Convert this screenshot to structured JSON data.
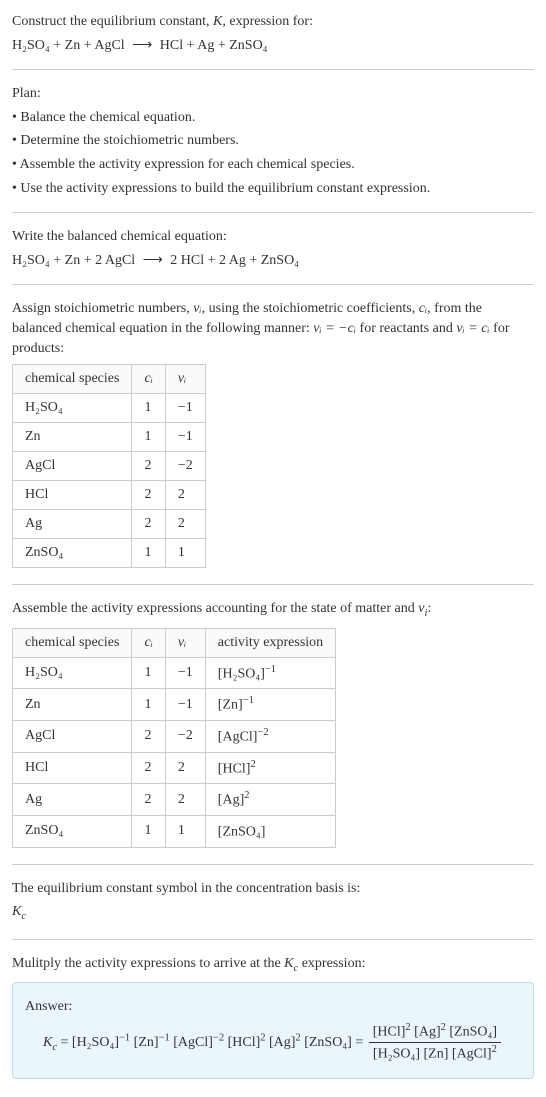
{
  "intro": {
    "line1": "Construct the equilibrium constant, K, expression for:",
    "equation_left": "H₂SO₄ + Zn + AgCl",
    "equation_right": "HCl + Ag + ZnSO₄"
  },
  "plan": {
    "heading": "Plan:",
    "items": [
      "• Balance the chemical equation.",
      "• Determine the stoichiometric numbers.",
      "• Assemble the activity expression for each chemical species.",
      "• Use the activity expressions to build the equilibrium constant expression."
    ]
  },
  "balanced": {
    "heading": "Write the balanced chemical equation:",
    "left": "H₂SO₄ + Zn + 2 AgCl",
    "right": "2 HCl + 2 Ag + ZnSO₄"
  },
  "stoich": {
    "heading_part1": "Assign stoichiometric numbers, ",
    "heading_part2": ", using the stoichiometric coefficients, ",
    "heading_part3": ", from the balanced chemical equation in the following manner: ",
    "heading_part4": " for reactants and ",
    "heading_part5": " for products:",
    "vi": "νᵢ",
    "ci": "cᵢ",
    "rel1": "νᵢ = −cᵢ",
    "rel2": "νᵢ = cᵢ",
    "table": {
      "headers": [
        "chemical species",
        "cᵢ",
        "νᵢ"
      ],
      "rows": [
        [
          "H₂SO₄",
          "1",
          "−1"
        ],
        [
          "Zn",
          "1",
          "−1"
        ],
        [
          "AgCl",
          "2",
          "−2"
        ],
        [
          "HCl",
          "2",
          "2"
        ],
        [
          "Ag",
          "2",
          "2"
        ],
        [
          "ZnSO₄",
          "1",
          "1"
        ]
      ]
    }
  },
  "activity": {
    "heading": "Assemble the activity expressions accounting for the state of matter and νᵢ:",
    "table": {
      "headers": [
        "chemical species",
        "cᵢ",
        "νᵢ",
        "activity expression"
      ],
      "rows": [
        {
          "sp": "H₂SO₄",
          "c": "1",
          "v": "−1",
          "base": "[H₂SO₄]",
          "exp": "−1"
        },
        {
          "sp": "Zn",
          "c": "1",
          "v": "−1",
          "base": "[Zn]",
          "exp": "−1"
        },
        {
          "sp": "AgCl",
          "c": "2",
          "v": "−2",
          "base": "[AgCl]",
          "exp": "−2"
        },
        {
          "sp": "HCl",
          "c": "2",
          "v": "2",
          "base": "[HCl]",
          "exp": "2"
        },
        {
          "sp": "Ag",
          "c": "2",
          "v": "2",
          "base": "[Ag]",
          "exp": "2"
        },
        {
          "sp": "ZnSO₄",
          "c": "1",
          "v": "1",
          "base": "[ZnSO₄]",
          "exp": ""
        }
      ]
    }
  },
  "symbol": {
    "line1": "The equilibrium constant symbol in the concentration basis is:",
    "kc": "K",
    "c": "c"
  },
  "multiply": {
    "heading": "Mulitply the activity expressions to arrive at the Kc expression:"
  },
  "answer": {
    "label": "Answer:",
    "kc": "K",
    "c": "c",
    "flat_terms": [
      {
        "base": "[H₂SO₄]",
        "exp": "−1"
      },
      {
        "base": "[Zn]",
        "exp": "−1"
      },
      {
        "base": "[AgCl]",
        "exp": "−2"
      },
      {
        "base": "[HCl]",
        "exp": "2"
      },
      {
        "base": "[Ag]",
        "exp": "2"
      },
      {
        "base": "[ZnSO₄]",
        "exp": ""
      }
    ],
    "frac_num": [
      {
        "base": "[HCl]",
        "exp": "2"
      },
      {
        "base": "[Ag]",
        "exp": "2"
      },
      {
        "base": "[ZnSO₄]",
        "exp": ""
      }
    ],
    "frac_den": [
      {
        "base": "[H₂SO₄]",
        "exp": ""
      },
      {
        "base": "[Zn]",
        "exp": ""
      },
      {
        "base": "[AgCl]",
        "exp": "2"
      }
    ]
  }
}
